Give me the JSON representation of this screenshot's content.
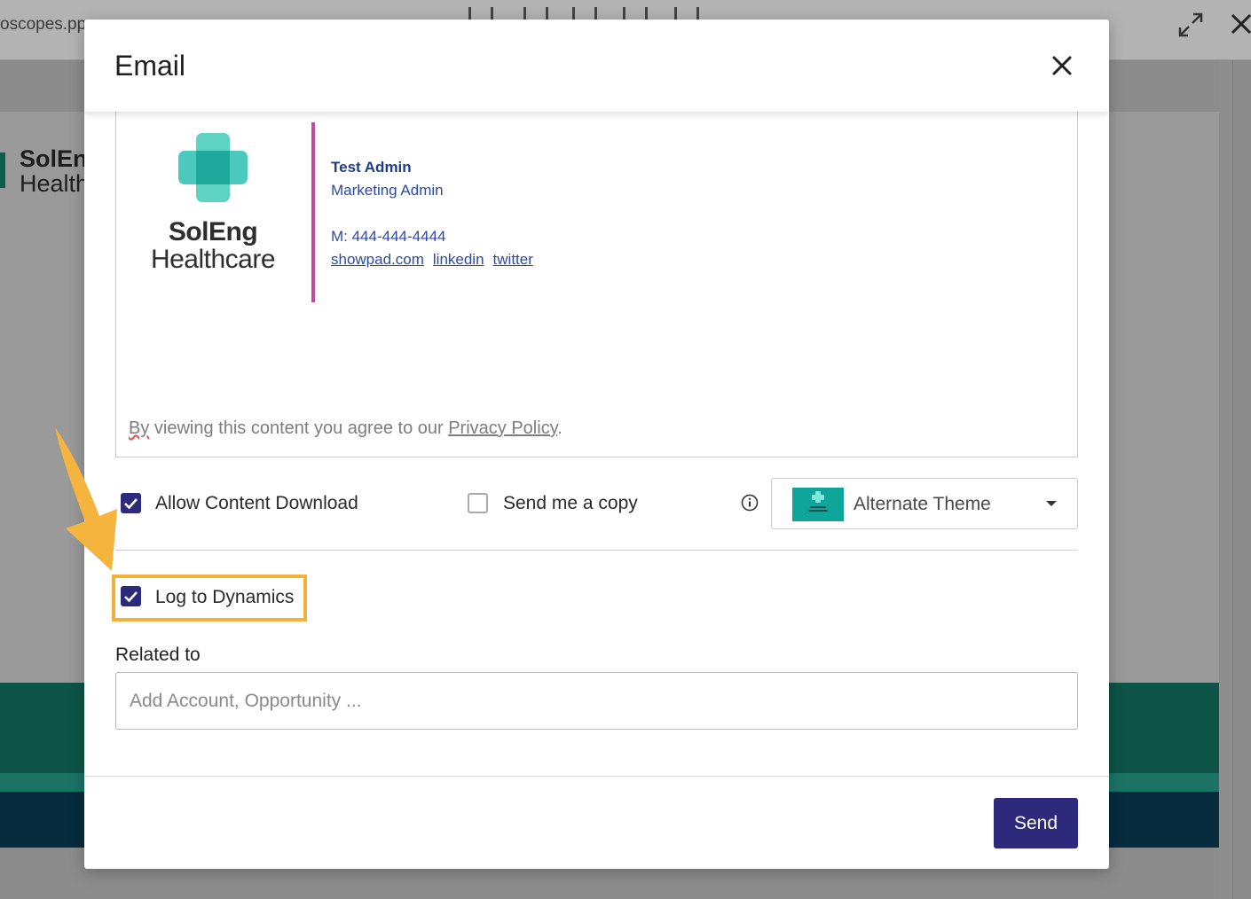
{
  "background": {
    "filename": "oscopes.pp",
    "logo_line1": "SolEng",
    "logo_line2": "Health"
  },
  "modal": {
    "title": "Email",
    "close_icon": "close-icon"
  },
  "signature": {
    "logo_line1": "SolEng",
    "logo_line2": "Healthcare",
    "name": "Test Admin",
    "role": "Marketing Admin",
    "phone": "M: 444-444-4444",
    "links": [
      "showpad.com",
      "linkedin",
      "twitter"
    ]
  },
  "privacy": {
    "word_by": "By",
    "prefix": " viewing this content you agree to our ",
    "link": "Privacy Policy",
    "suffix": "."
  },
  "options": {
    "allow_download": {
      "label": "Allow Content Download",
      "checked": true
    },
    "send_copy": {
      "label": "Send me a copy",
      "checked": false
    },
    "log_dynamics": {
      "label": "Log to Dynamics",
      "checked": true
    }
  },
  "theme": {
    "selected": "Alternate Theme"
  },
  "related": {
    "label": "Related to",
    "placeholder": "Add Account, Opportunity ..."
  },
  "footer": {
    "send_label": "Send"
  },
  "colors": {
    "primary": "#2d2a7c",
    "highlight": "#f2b13a",
    "signature_divider": "#c04b9b",
    "signature_text": "#2b4aa5"
  }
}
